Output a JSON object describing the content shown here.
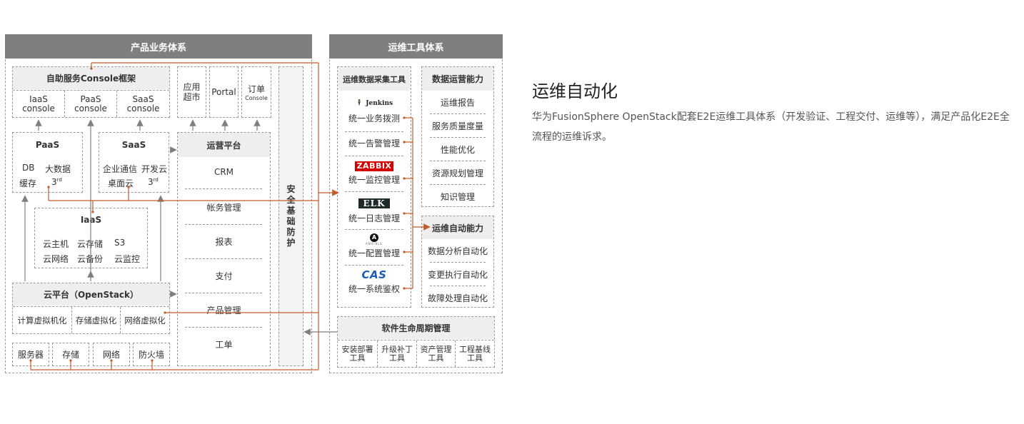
{
  "left_panel": {
    "header": "产品业务体系",
    "console_frame": {
      "title": "自助服务Console框架",
      "items": [
        {
          "line1": "IaaS",
          "line2": "console"
        },
        {
          "line1": "PaaS",
          "line2": "console"
        },
        {
          "line1": "SaaS",
          "line2": "console"
        }
      ]
    },
    "top_apps": [
      {
        "line1": "应用",
        "line2": "超市"
      },
      {
        "line1": "Portal",
        "line2": ""
      },
      {
        "line1": "订单",
        "line2": "Console"
      }
    ],
    "paas": {
      "title": "PaaS",
      "row1": [
        "DB",
        "大数据"
      ],
      "row2": [
        "缓存",
        "3rd"
      ]
    },
    "saas": {
      "title": "SaaS",
      "row1": [
        "企业通信",
        "开发云"
      ],
      "row2": [
        "桌面云",
        "3rd"
      ]
    },
    "iaas": {
      "title": "IaaS",
      "row1": [
        "云主机",
        "云存储",
        "S3"
      ],
      "row2": [
        "云网络",
        "云备份",
        "云监控"
      ]
    },
    "cloud_platform": {
      "title": "云平台（OpenStack）",
      "items": [
        "计算虚拟机化",
        "存储虚拟化",
        "网络虚拟化"
      ]
    },
    "hardware": [
      "服务器",
      "存储",
      "网络",
      "防火墙"
    ],
    "ops_platform": {
      "title": "运营平台",
      "items": [
        "CRM",
        "帐务管理",
        "报表",
        "支付",
        "产品管理",
        "工单"
      ]
    },
    "security": "安全基础防护"
  },
  "right_panel": {
    "header": "运维工具体系",
    "collect": {
      "title": "运维数据采集工具",
      "items": [
        {
          "logo": "Jenkins",
          "label": "统一业务拨测"
        },
        {
          "logo": "",
          "label": "统一告警管理"
        },
        {
          "logo": "ZABBIX",
          "label": "统一监控管理"
        },
        {
          "logo": "ELK",
          "label": "统一日志管理"
        },
        {
          "logo": "A",
          "logo_sub": "ANSIBLE",
          "label": "统一配置管理"
        },
        {
          "logo": "CAS",
          "label": "统一系统鉴权"
        }
      ]
    },
    "data_ops": {
      "title": "数据运营能力",
      "items": [
        "运维报告",
        "服务质量度量",
        "性能优化",
        "资源规划管理",
        "知识管理"
      ]
    },
    "auto_ops": {
      "title": "运维自动能力",
      "items": [
        "数据分析自动化",
        "变更执行自动化",
        "故障处理自动化"
      ]
    },
    "lifecycle": {
      "title": "软件生命周期管理",
      "items": [
        {
          "line1": "安装部署",
          "line2": "工具"
        },
        {
          "line1": "升级补丁",
          "line2": "工具"
        },
        {
          "line1": "资产管理",
          "line2": "工具"
        },
        {
          "line1": "工程基线",
          "line2": "工具"
        }
      ]
    }
  },
  "article": {
    "title": "运维自动化",
    "description": "华为FusionSphere OpenStack配套E2E运维工具体系（开发验证、工程交付、运维等），满足产品化E2E全流程的运维诉求。"
  },
  "colors": {
    "header_gray": "#7f7f7f",
    "connector_orange": "#c55a2b",
    "arrow_gray": "#7f7f7f"
  }
}
